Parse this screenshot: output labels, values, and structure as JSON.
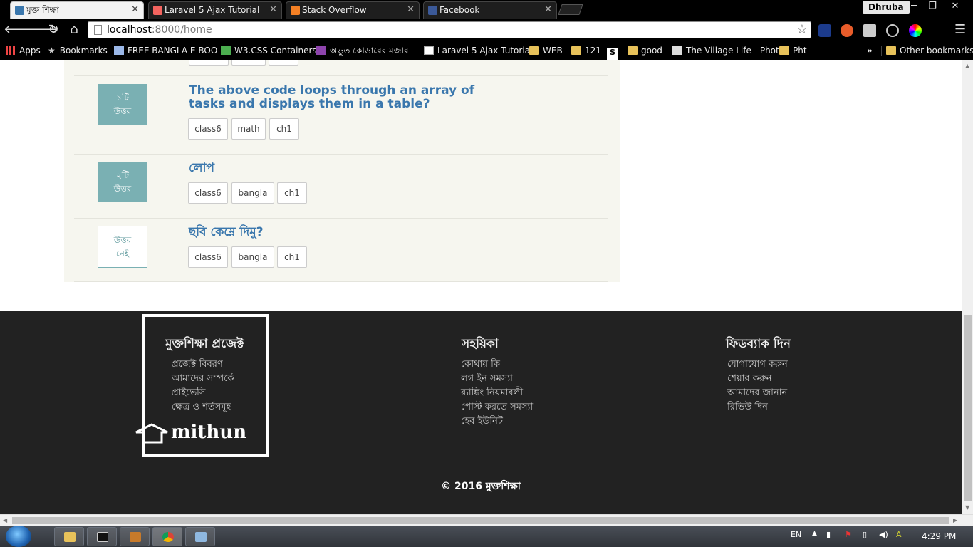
{
  "browser": {
    "tabs": [
      {
        "title": "মুক্ত শিক্ষা",
        "active": true,
        "favicon_color": "#3a77ad"
      },
      {
        "title": "Laravel 5 Ajax Tutorial",
        "active": false,
        "favicon_color": "#f4645f"
      },
      {
        "title": "Stack Overflow",
        "active": false,
        "favicon_color": "#f48024"
      },
      {
        "title": "Facebook",
        "active": false,
        "favicon_color": "#3b5998"
      }
    ],
    "profile_name": "Dhruba",
    "url_host": "localhost",
    "url_path": ":8000/home",
    "bookmarks": [
      {
        "label": "Apps",
        "icon": "apps-grid-icon"
      },
      {
        "label": "Bookmarks",
        "icon": "star-icon"
      },
      {
        "label": "FREE BANGLA E-BOO",
        "icon": "book-icon"
      },
      {
        "label": "W3.CSS Containers",
        "icon": "w3-icon"
      },
      {
        "label": "অভুত কোডারের মজার",
        "icon": "purple-icon"
      },
      {
        "label": "Laravel 5 Ajax Tutorial",
        "icon": "page-icon"
      },
      {
        "label": "WEB",
        "icon": "folder-icon"
      },
      {
        "label": "121",
        "icon": "folder-icon"
      },
      {
        "label": "",
        "icon": "s-icon"
      },
      {
        "label": "good",
        "icon": "folder-icon"
      },
      {
        "label": "The Village Life - Phot",
        "icon": "camera-icon"
      },
      {
        "label": "Pht",
        "icon": "folder-icon"
      }
    ],
    "overflow_label": "»",
    "other_bookmarks": "Other bookmarks"
  },
  "questions": [
    {
      "answer_count": "১টি",
      "answer_word": "উত্তর",
      "title": "The above code loops through an array of tasks and displays them in a table?",
      "tags": [
        "class6",
        "math",
        "ch1"
      ]
    },
    {
      "answer_count": "২টি",
      "answer_word": "উত্তর",
      "title": "লোপ",
      "tags": [
        "class6",
        "bangla",
        "ch1"
      ]
    },
    {
      "answer_count": "উত্তর",
      "answer_word": "নেই",
      "title": "ছবি কেম্নে দিমু?",
      "tags": [
        "class6",
        "bangla",
        "ch1"
      ]
    }
  ],
  "footer": {
    "col1": {
      "title": "মুক্তশিক্ষা প্রজেক্ট",
      "links": [
        "প্রজেক্ট বিবরণ",
        "আমাদের সম্পর্কে",
        "প্রাইভেসি",
        "ক্ষেত্র ও শর্তসমূহ"
      ]
    },
    "col2": {
      "title": "সহয়িকা",
      "links": [
        "কোথায় কি",
        "লগ ইন সমস্যা",
        "র‍্যাঙ্কিং নিয়মাবলী",
        "পোস্ট করতে সমস্যা",
        "হেব ইউনিট"
      ]
    },
    "col3": {
      "title": "ফিডব্যাক দিন",
      "links": [
        "যোগাযোগ করুন",
        "শেয়ার করুন",
        "আমাদের জানান",
        "রিভিউ দিন"
      ]
    },
    "annotation": "mithun",
    "copyright": "© 2016 মুক্তশিক্ষা"
  },
  "taskbar": {
    "language": "EN",
    "time": "4:29 PM"
  }
}
